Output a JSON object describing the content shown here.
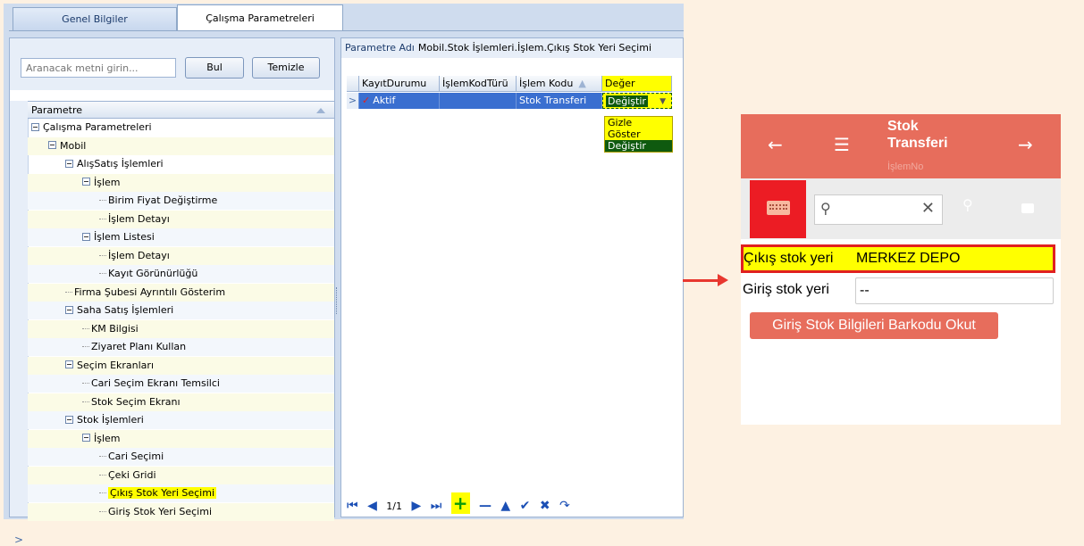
{
  "tabs": {
    "general": "Genel Bilgiler",
    "params": "Çalışma Parametreleri"
  },
  "search": {
    "placeholder": "Aranacak metni girin...",
    "find_label": "Bul",
    "clear_label": "Temizle"
  },
  "tree": {
    "header": "Parametre",
    "items": [
      {
        "label": "Çalışma Parametreleri",
        "level": 0,
        "toggle": true
      },
      {
        "label": "Mobil",
        "level": 1,
        "toggle": true
      },
      {
        "label": "AlışSatış İşlemleri",
        "level": 2,
        "toggle": true
      },
      {
        "label": "İşlem",
        "level": 3,
        "toggle": true
      },
      {
        "label": "Birim Fiyat Değiştirme",
        "level": 4,
        "toggle": false
      },
      {
        "label": "İşlem Detayı",
        "level": 4,
        "toggle": false
      },
      {
        "label": "İşlem Listesi",
        "level": 3,
        "toggle": true
      },
      {
        "label": "İşlem Detayı",
        "level": 4,
        "toggle": false
      },
      {
        "label": "Kayıt Görünürlüğü",
        "level": 4,
        "toggle": false
      },
      {
        "label": "Firma Şubesi Ayrıntılı Gösterim",
        "level": 2,
        "toggle": false
      },
      {
        "label": "Saha Satış İşlemleri",
        "level": 2,
        "toggle": true
      },
      {
        "label": "KM Bilgisi",
        "level": 3,
        "toggle": false
      },
      {
        "label": "Ziyaret Planı Kullan",
        "level": 3,
        "toggle": false
      },
      {
        "label": "Seçim Ekranları",
        "level": 2,
        "toggle": true
      },
      {
        "label": "Cari Seçim Ekranı Temsilci",
        "level": 3,
        "toggle": false
      },
      {
        "label": "Stok Seçim Ekranı",
        "level": 3,
        "toggle": false
      },
      {
        "label": "Stok İşlemleri",
        "level": 2,
        "toggle": true
      },
      {
        "label": "İşlem",
        "level": 3,
        "toggle": true
      },
      {
        "label": "Cari Seçimi",
        "level": 4,
        "toggle": false
      },
      {
        "label": "Çeki Gridi",
        "level": 4,
        "toggle": false
      },
      {
        "label": "Çıkış Stok Yeri Seçimi",
        "level": 4,
        "toggle": false,
        "highlight": true
      },
      {
        "label": "Giriş Stok Yeri Seçimi",
        "level": 4,
        "toggle": false
      }
    ]
  },
  "param": {
    "label": "Parametre Adı",
    "value": "Mobil.Stok İşlemleri.İşlem.Çıkış Stok Yeri Seçimi"
  },
  "grid": {
    "columns": [
      "KayıtDurumu",
      "İşlemKodTürü",
      "İşlem Kodu",
      "Değer"
    ],
    "row": {
      "status": "Aktif",
      "type": "",
      "code": "Stok Transferi",
      "value": "Değiştir"
    },
    "options": [
      "Gizle",
      "Göster",
      "Değiştir"
    ],
    "selected_option": "Değiştir"
  },
  "pager": {
    "page": "1/1"
  },
  "phone": {
    "title": "Stok Transferi",
    "subtitle": "İşlemNo",
    "out_label": "Çıkış stok yeri",
    "out_value": "MERKEZ DEPO",
    "in_label": "Giriş stok yeri",
    "in_value": "-- ",
    "scan_button": "Giriş Stok Bilgileri Barkodu Okut",
    "colors": {
      "header": "#e76d5c",
      "highlight": "#ffff00",
      "frame": "#e02020"
    }
  }
}
